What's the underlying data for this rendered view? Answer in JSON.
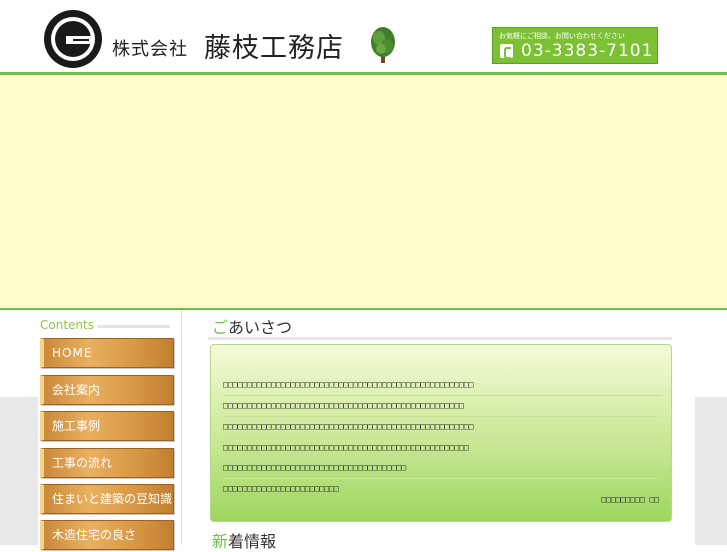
{
  "header": {
    "company_prefix": "株式会社",
    "company_name": "藤枝工務店",
    "logo_icon": "company-logo-mark",
    "tree_icon": "tree-icon",
    "phone_caption": "お気軽にご相談、お問い合わせください",
    "phone_number": "03-3383-7101"
  },
  "sidebar": {
    "title": "Contents",
    "items": [
      {
        "label": "HOME"
      },
      {
        "label": "会社案内"
      },
      {
        "label": "施工事例"
      },
      {
        "label": "工事の流れ"
      },
      {
        "label": "住まいと建築の豆知識"
      },
      {
        "label": "木造住宅の良さ"
      }
    ]
  },
  "main": {
    "greeting_title_first": "ご",
    "greeting_title_rest": "あいさつ",
    "greeting_lines": [
      "□□□□□□□□□□□□□□□□□□□□□□□□□□□□□□□□□□□□□□□□□□□□□□□□□□□□",
      "□□□□□□□□□□□□□□□□□□□□□□□□□□□□□□□□□□□□□□□□□□□□□□□□□□",
      "□□□□□□□□□□□□□□□□□□□□□□□□□□□□□□□□□□□□□□□□□□□□□□□□□□□□",
      "□□□□□□□□□□□□□□□□□□□□□□□□□□□□□□□□□□□□□□□□□□□□□□□□□□□",
      "□□□□□□□□□□□□□□□□□□□□□□□□□□□□□□□□□□□□□□",
      "□□□□□□□□□□□□□□□□□□□□□□□□"
    ],
    "greeting_signature": "□□□□□□□□□ □□",
    "news_title_first": "新",
    "news_title_rest": "着情報"
  },
  "colors": {
    "accent_green": "#6cbf4a",
    "banner_bg": "#fffccc",
    "nav_orange": "#d89845"
  }
}
